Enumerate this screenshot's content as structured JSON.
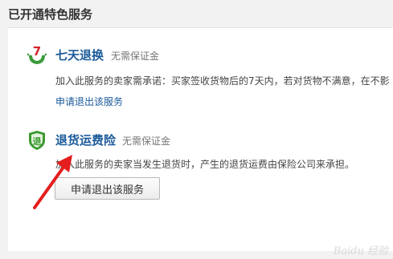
{
  "header": {
    "title": "已开通特色服务"
  },
  "services": [
    {
      "name": "七天退换",
      "note": "无需保证金",
      "description": "加入此服务的卖家需承诺：买家签收货物后的7天内，若对货物不满意，在不影",
      "action_label": "申请退出该服务",
      "icon_text": "7",
      "icon": "seven-day-return-icon"
    },
    {
      "name": "退货运费险",
      "note": "无需保证金",
      "description": "加入此服务的卖家当发生退货时，产生的退货运费由保险公司来承担。",
      "action_label": "申请退出该服务",
      "icon_text": "退",
      "icon": "shield-icon"
    }
  ],
  "watermark": "Baidu 经验",
  "colors": {
    "link": "#1a5a99",
    "arrow": "#e41e1e",
    "shield": "#3a9a2f",
    "seven": "#d6262b"
  }
}
